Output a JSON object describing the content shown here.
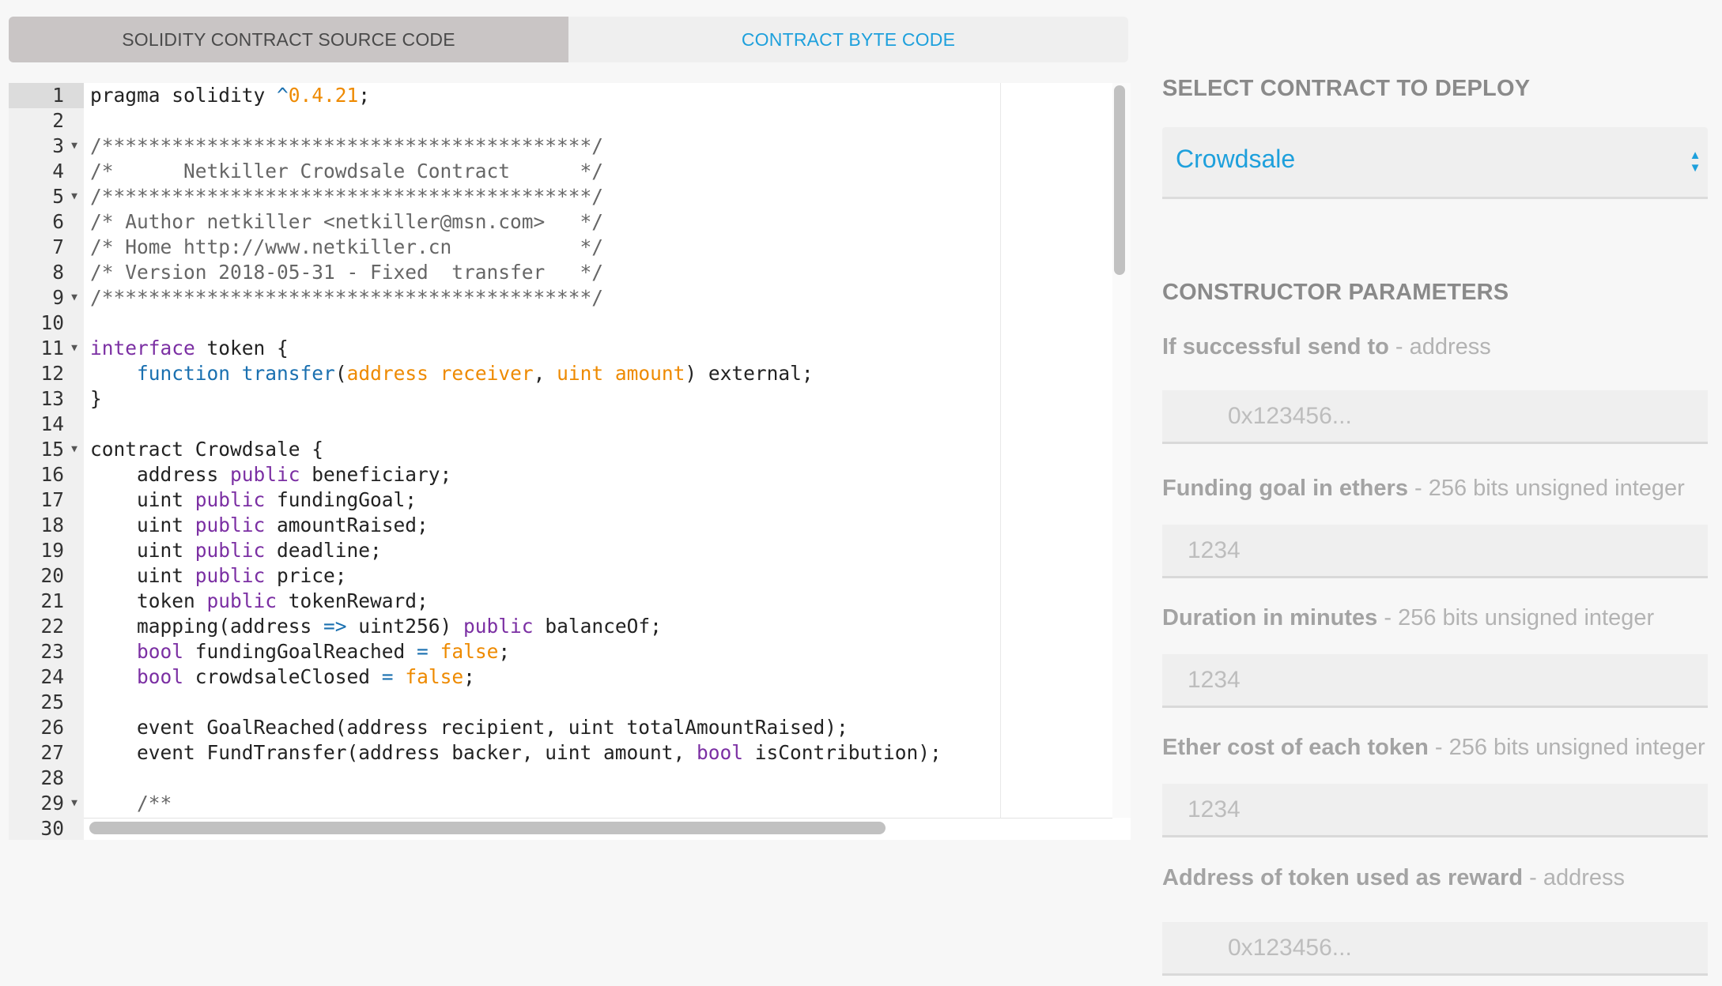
{
  "tabs": {
    "source_label": "SOLIDITY CONTRACT SOURCE CODE",
    "bytecode_label": "CONTRACT BYTE CODE"
  },
  "editor": {
    "active_line": 1,
    "lines": [
      {
        "n": "1",
        "fold": false,
        "t": [
          [
            "pragma solidity ",
            ""
          ],
          [
            "^",
            "op"
          ],
          [
            "0.4.21",
            "num"
          ],
          [
            ";",
            ""
          ]
        ]
      },
      {
        "n": "2",
        "fold": false,
        "t": []
      },
      {
        "n": "3",
        "fold": true,
        "t": [
          [
            "/******************************************/",
            "cmt"
          ]
        ]
      },
      {
        "n": "4",
        "fold": false,
        "t": [
          [
            "/*      Netkiller Crowdsale Contract      */",
            "cmt"
          ]
        ]
      },
      {
        "n": "5",
        "fold": true,
        "t": [
          [
            "/******************************************/",
            "cmt"
          ]
        ]
      },
      {
        "n": "6",
        "fold": false,
        "t": [
          [
            "/* Author netkiller <netkiller@msn.com>   */",
            "cmt"
          ]
        ]
      },
      {
        "n": "7",
        "fold": false,
        "t": [
          [
            "/* Home http://www.netkiller.cn           */",
            "cmt"
          ]
        ]
      },
      {
        "n": "8",
        "fold": false,
        "t": [
          [
            "/* Version 2018-05-31 - Fixed  transfer   */",
            "cmt"
          ]
        ]
      },
      {
        "n": "9",
        "fold": true,
        "t": [
          [
            "/******************************************/",
            "cmt"
          ]
        ]
      },
      {
        "n": "10",
        "fold": false,
        "t": []
      },
      {
        "n": "11",
        "fold": true,
        "t": [
          [
            "interface",
            "kw"
          ],
          [
            " token {",
            ""
          ]
        ]
      },
      {
        "n": "12",
        "fold": false,
        "t": [
          [
            "    ",
            ""
          ],
          [
            "function",
            "fn"
          ],
          [
            " ",
            ""
          ],
          [
            "transfer",
            "fn"
          ],
          [
            "(",
            ""
          ],
          [
            "address receiver",
            "par"
          ],
          [
            ", ",
            ""
          ],
          [
            "uint amount",
            "par"
          ],
          [
            ") external;",
            ""
          ]
        ]
      },
      {
        "n": "13",
        "fold": false,
        "t": [
          [
            "}",
            ""
          ]
        ]
      },
      {
        "n": "14",
        "fold": false,
        "t": []
      },
      {
        "n": "15",
        "fold": true,
        "t": [
          [
            "contract Crowdsale {",
            ""
          ]
        ]
      },
      {
        "n": "16",
        "fold": false,
        "t": [
          [
            "    address ",
            ""
          ],
          [
            "public",
            "kw"
          ],
          [
            " beneficiary;",
            ""
          ]
        ]
      },
      {
        "n": "17",
        "fold": false,
        "t": [
          [
            "    uint ",
            ""
          ],
          [
            "public",
            "kw"
          ],
          [
            " fundingGoal;",
            ""
          ]
        ]
      },
      {
        "n": "18",
        "fold": false,
        "t": [
          [
            "    uint ",
            ""
          ],
          [
            "public",
            "kw"
          ],
          [
            " amountRaised;",
            ""
          ]
        ]
      },
      {
        "n": "19",
        "fold": false,
        "t": [
          [
            "    uint ",
            ""
          ],
          [
            "public",
            "kw"
          ],
          [
            " deadline;",
            ""
          ]
        ]
      },
      {
        "n": "20",
        "fold": false,
        "t": [
          [
            "    uint ",
            ""
          ],
          [
            "public",
            "kw"
          ],
          [
            " price;",
            ""
          ]
        ]
      },
      {
        "n": "21",
        "fold": false,
        "t": [
          [
            "    token ",
            ""
          ],
          [
            "public",
            "kw"
          ],
          [
            " tokenReward;",
            ""
          ]
        ]
      },
      {
        "n": "22",
        "fold": false,
        "t": [
          [
            "    mapping(address ",
            ""
          ],
          [
            "=>",
            "op"
          ],
          [
            " uint256) ",
            ""
          ],
          [
            "public",
            "kw"
          ],
          [
            " balanceOf;",
            ""
          ]
        ]
      },
      {
        "n": "23",
        "fold": false,
        "t": [
          [
            "    ",
            ""
          ],
          [
            "bool",
            "kw"
          ],
          [
            " fundingGoalReached ",
            ""
          ],
          [
            "=",
            "op"
          ],
          [
            " ",
            ""
          ],
          [
            "false",
            "num"
          ],
          [
            ";",
            ""
          ]
        ]
      },
      {
        "n": "24",
        "fold": false,
        "t": [
          [
            "    ",
            ""
          ],
          [
            "bool",
            "kw"
          ],
          [
            " crowdsaleClosed ",
            ""
          ],
          [
            "=",
            "op"
          ],
          [
            " ",
            ""
          ],
          [
            "false",
            "num"
          ],
          [
            ";",
            ""
          ]
        ]
      },
      {
        "n": "25",
        "fold": false,
        "t": []
      },
      {
        "n": "26",
        "fold": false,
        "t": [
          [
            "    event GoalReached(address recipient, uint totalAmountRaised);",
            ""
          ]
        ]
      },
      {
        "n": "27",
        "fold": false,
        "t": [
          [
            "    event FundTransfer(address backer, uint amount, ",
            ""
          ],
          [
            "bool",
            "kw"
          ],
          [
            " isContribution);",
            ""
          ]
        ]
      },
      {
        "n": "28",
        "fold": false,
        "t": []
      },
      {
        "n": "29",
        "fold": true,
        "t": [
          [
            "    /**",
            "cmt"
          ]
        ]
      },
      {
        "n": "30",
        "fold": false,
        "t": []
      }
    ]
  },
  "deploy": {
    "heading": "SELECT CONTRACT TO DEPLOY",
    "selected": "Crowdsale"
  },
  "constructor": {
    "heading": "CONSTRUCTOR PARAMETERS",
    "params": [
      {
        "label": "If successful send to",
        "type": " - address",
        "placeholder": "0x123456...",
        "kind": "addr"
      },
      {
        "label": "Funding goal in ethers",
        "type": " - 256 bits unsigned integer",
        "placeholder": "1234",
        "kind": "num"
      },
      {
        "label": "Duration in minutes",
        "type": " - 256 bits unsigned integer",
        "placeholder": "1234",
        "kind": "num"
      },
      {
        "label": "Ether cost of each token",
        "type": " - 256 bits unsigned integer",
        "placeholder": "1234",
        "kind": "num"
      },
      {
        "label": "Address of token used as reward",
        "type": " - address",
        "placeholder": "0x123456...",
        "kind": "addr"
      }
    ]
  },
  "colors": {
    "accent": "#1ea0dc",
    "keyword": "#7b2fa3",
    "number": "#ee8a00"
  }
}
